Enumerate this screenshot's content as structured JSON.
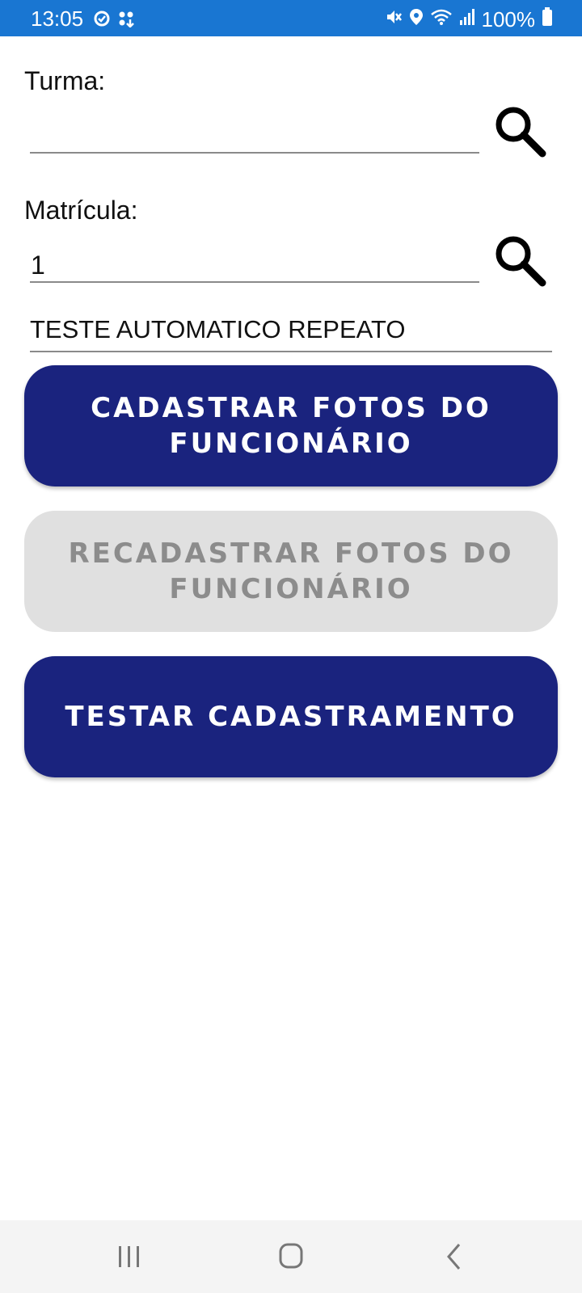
{
  "status_bar": {
    "time": "13:05",
    "battery": "100%",
    "icons": [
      "sync-icon",
      "apps-icon",
      "mute-icon",
      "location-icon",
      "wifi-icon",
      "signal-icon",
      "battery-icon"
    ],
    "background": "#1976d2"
  },
  "form": {
    "turma": {
      "label": "Turma:",
      "value": ""
    },
    "matricula": {
      "label": "Matrícula:",
      "value": "1"
    },
    "employee_name": "TESTE AUTOMATICO REPEATO"
  },
  "buttons": {
    "register_photos": "CADASTRAR FOTOS DO FUNCIONÁRIO",
    "reregister_photos": "RECADASTRAR FOTOS DO FUNCIONÁRIO",
    "test_registration": "TESTAR CADASTRAMENTO"
  },
  "colors": {
    "primary": "#1a237e",
    "disabled": "#e0e0e0",
    "disabled_text": "#8c8c8c"
  },
  "nav_bar": {
    "icons": [
      "recents-icon",
      "home-icon",
      "back-icon"
    ]
  }
}
